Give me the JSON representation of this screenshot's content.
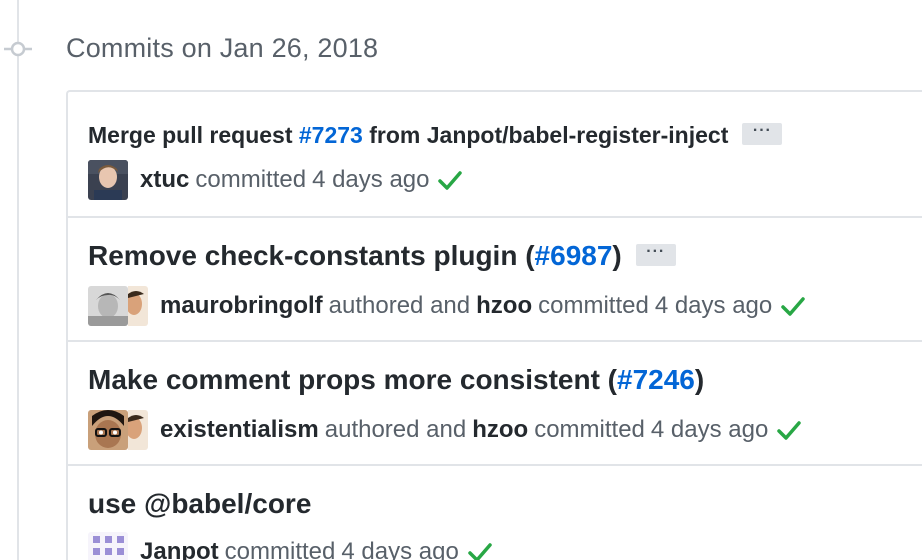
{
  "heading": "Commits on Jan 26, 2018",
  "commits": [
    {
      "title_prefix": "Merge pull request ",
      "issue": "#7273",
      "title_suffix": " from Janpot/babel-register-inject",
      "ellipsis": "···",
      "committer": "xtuc",
      "committed_label": "committed",
      "time": "4 days ago"
    },
    {
      "title_prefix": "Remove check-constants plugin (",
      "issue": "#6987",
      "title_suffix": ")",
      "ellipsis": "···",
      "author": "maurobringolf",
      "authored_label": "authored and",
      "committer": "hzoo",
      "committed_label": "committed",
      "time": "4 days ago"
    },
    {
      "title_prefix": "Make comment props more consistent (",
      "issue": "#7246",
      "title_suffix": ")",
      "author": "existentialism",
      "authored_label": "authored and",
      "committer": "hzoo",
      "committed_label": "committed",
      "time": "4 days ago"
    },
    {
      "title_prefix": "use @babel/core",
      "committer": "Janpot",
      "committed_label": "committed",
      "time": "4 days ago"
    }
  ],
  "colors": {
    "link": "#0366d6",
    "success": "#28a745",
    "muted": "#586069",
    "border": "#e1e4e8"
  },
  "icons": {
    "timeline": "git-commit-icon",
    "status": "check-icon"
  }
}
